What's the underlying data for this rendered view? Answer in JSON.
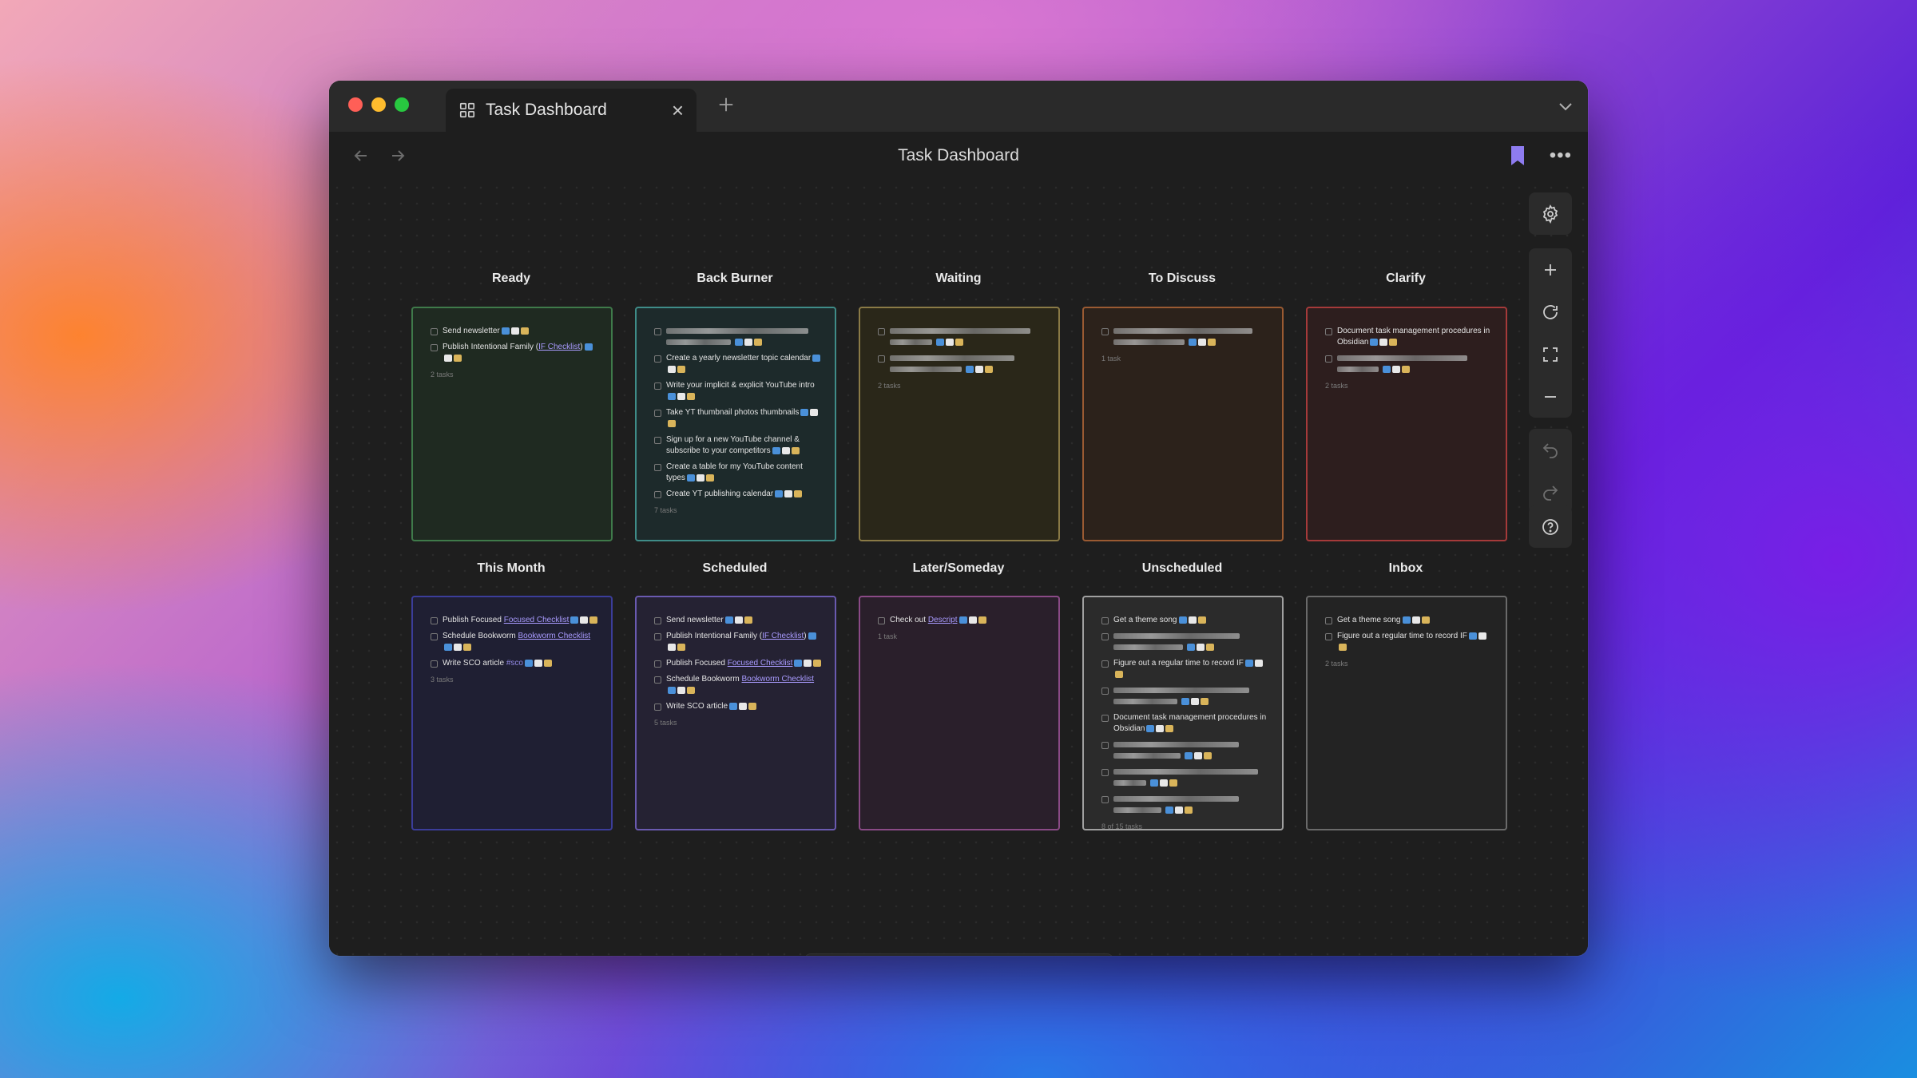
{
  "window": {
    "tab_title": "Task Dashboard",
    "page_title": "Task Dashboard",
    "accent_color": "#8e7cf0"
  },
  "icons": {
    "tab": "grid-icon",
    "close": "close-icon",
    "new_tab": "plus-icon",
    "tab_list": "chevron-down-icon",
    "back": "arrow-left-icon",
    "forward": "arrow-right-icon",
    "bookmark": "bookmark-icon",
    "more": "more-icon"
  },
  "toolbar": {
    "settings": "gear-icon",
    "zoom_in": "plus-icon",
    "reset_zoom": "refresh-icon",
    "fit": "expand-icon",
    "zoom_out": "minus-icon",
    "undo": "undo-icon",
    "redo": "redo-icon",
    "help": "help-icon"
  },
  "columns": [
    {
      "title": "Ready",
      "border": "#3f7a4a",
      "bg": "#1f2a21",
      "tasks": [
        {
          "text": "Send newsletter",
          "blurred": false
        },
        {
          "text": "Publish Intentional Family (",
          "link": "IF Checklist",
          "after": ")",
          "blurred": false
        }
      ],
      "count": "2 tasks"
    },
    {
      "title": "Back Burner",
      "border": "#3f8c88",
      "bg": "#1d2a2b",
      "tasks": [
        {
          "blurred": true
        },
        {
          "text": "Create a yearly newsletter topic calendar",
          "blurred": false
        },
        {
          "text": "Write your implicit & explicit YouTube intro",
          "blurred": false
        },
        {
          "text": "Take YT thumbnail photos thumbnails",
          "blurred": false
        },
        {
          "text": "Sign up for a new YouTube channel & subscribe to your competitors",
          "blurred": false
        },
        {
          "text": "Create a table for my YouTube content types",
          "blurred": false
        },
        {
          "text": "Create YT publishing calendar",
          "blurred": false
        }
      ],
      "count": "7 tasks"
    },
    {
      "title": "Waiting",
      "border": "#8a7a46",
      "bg": "#2a2719",
      "tasks": [
        {
          "blurred": true
        },
        {
          "blurred": true
        }
      ],
      "count": "2 tasks"
    },
    {
      "title": "To Discuss",
      "border": "#9a5a32",
      "bg": "#2c221b",
      "tasks": [
        {
          "blurred": true
        }
      ],
      "count": "1 task"
    },
    {
      "title": "Clarify",
      "border": "#a53a3a",
      "bg": "#2d1e1e",
      "tasks": [
        {
          "text": "Document task management procedures in Obsidian",
          "blurred": false
        },
        {
          "blurred": true
        }
      ],
      "count": "2 tasks"
    },
    {
      "title": "This Month",
      "border": "#3b3d9a",
      "bg": "#1f1f33",
      "tasks": [
        {
          "text": "Publish Focused ",
          "link": "Focused Checklist",
          "blurred": false
        },
        {
          "text": "Schedule Bookworm ",
          "link": "Bookworm Checklist",
          "blurred": false
        },
        {
          "text": "Write SCO article ",
          "tag": "#sco",
          "blurred": false
        }
      ],
      "count": "3 tasks"
    },
    {
      "title": "Scheduled",
      "border": "#6a5ab0",
      "bg": "#252233",
      "tasks": [
        {
          "text": "Send newsletter",
          "blurred": false
        },
        {
          "text": "Publish Intentional Family (",
          "link": "IF Checklist",
          "after": ")",
          "blurred": false
        },
        {
          "text": "Publish Focused ",
          "link": "Focused Checklist",
          "blurred": false
        },
        {
          "text": "Schedule Bookworm ",
          "link": "Bookworm Checklist",
          "blurred": false
        },
        {
          "text": "Write SCO article",
          "blurred": false
        }
      ],
      "count": "5 tasks"
    },
    {
      "title": "Later/Someday",
      "border": "#8a4a86",
      "bg": "#2a1f2b",
      "tasks": [
        {
          "text": "Check out ",
          "link": "Descript",
          "blurred": false
        }
      ],
      "count": "1 task"
    },
    {
      "title": "Unscheduled",
      "border": "#a0a0a0",
      "bg": "#2b2b2b",
      "tasks": [
        {
          "text": "Get a theme song",
          "blurred": false
        },
        {
          "blurred": true
        },
        {
          "text": "Figure out a regular time to record IF",
          "blurred": false
        },
        {
          "blurred": true
        },
        {
          "text": "Document task management procedures in Obsidian",
          "blurred": false
        },
        {
          "blurred": true
        },
        {
          "blurred": true
        },
        {
          "blurred": true
        }
      ],
      "count": "8 of 15 tasks"
    },
    {
      "title": "Inbox",
      "border": "#6a6a6a",
      "bg": "#232323",
      "tasks": [
        {
          "text": "Get a theme song",
          "blurred": false
        },
        {
          "text": "Figure out a regular time to record IF",
          "blurred": false
        }
      ],
      "count": "2 tasks"
    }
  ],
  "bottom_bar": [
    "new-card-icon",
    "note-card-icon",
    "media-card-icon",
    "group-icon",
    "frame-icon"
  ]
}
